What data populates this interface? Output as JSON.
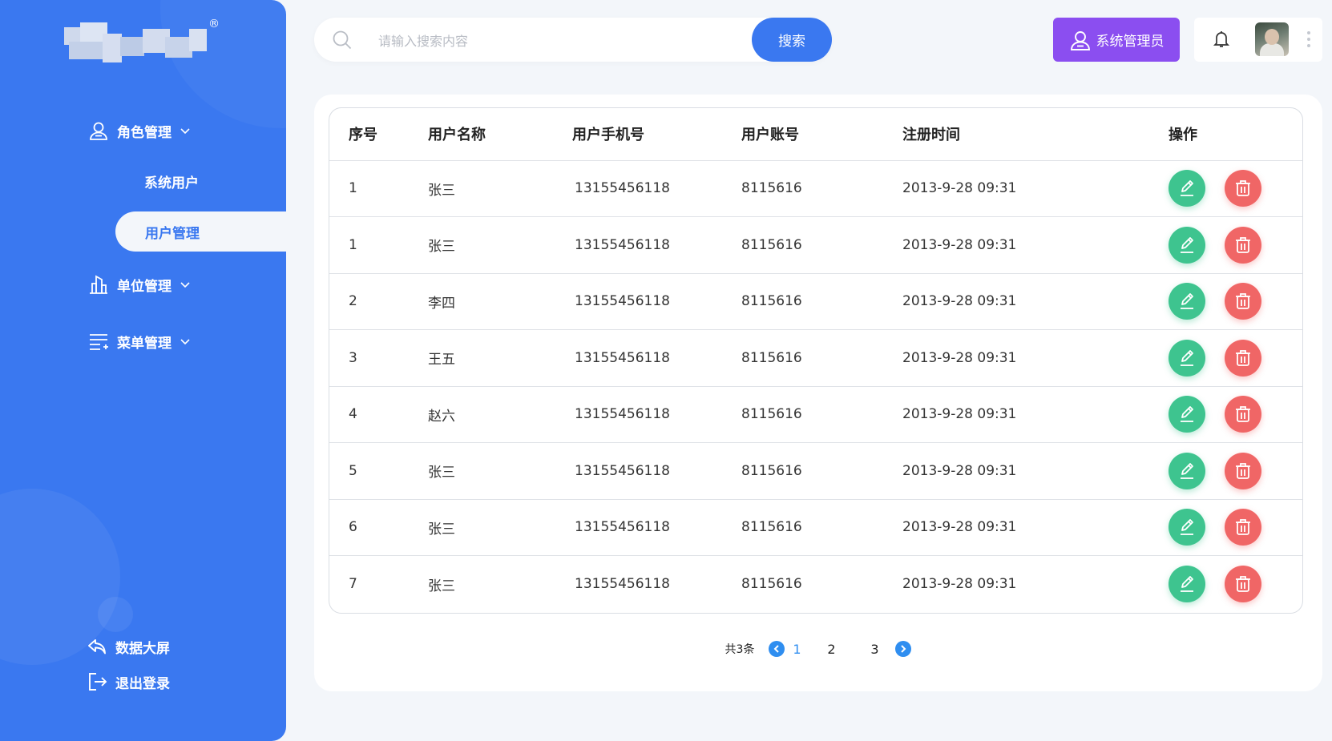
{
  "sidebar": {
    "nav": [
      {
        "label": "角色管理",
        "icon": "user-icon"
      },
      {
        "label": "单位管理",
        "icon": "building-icon"
      },
      {
        "label": "菜单管理",
        "icon": "menu-list-icon"
      }
    ],
    "sub_items": [
      {
        "label": "系统用户"
      },
      {
        "label": "用户管理",
        "active": true
      }
    ],
    "bottom": [
      {
        "label": "数据大屏",
        "icon": "back-arrow-icon"
      },
      {
        "label": "退出登录",
        "icon": "logout-icon"
      }
    ],
    "logo_mark": "®"
  },
  "header": {
    "search": {
      "placeholder": "请输入搜索内容",
      "value": ""
    },
    "search_button": "搜索",
    "admin_button": "系统管理员"
  },
  "table": {
    "columns": [
      "序号",
      "用户名称",
      "用户手机号",
      "用户账号",
      "注册时间",
      "操作"
    ],
    "rows": [
      {
        "index": "1",
        "name": "张三",
        "phone": "13155456118",
        "account": "8115616",
        "time": "2013-9-28 09:31"
      },
      {
        "index": "1",
        "name": "张三",
        "phone": "13155456118",
        "account": "8115616",
        "time": "2013-9-28 09:31"
      },
      {
        "index": "2",
        "name": "李四",
        "phone": "13155456118",
        "account": "8115616",
        "time": "2013-9-28 09:31"
      },
      {
        "index": "3",
        "name": "王五",
        "phone": "13155456118",
        "account": "8115616",
        "time": "2013-9-28 09:31"
      },
      {
        "index": "4",
        "name": "赵六",
        "phone": "13155456118",
        "account": "8115616",
        "time": "2013-9-28 09:31"
      },
      {
        "index": "5",
        "name": "张三",
        "phone": "13155456118",
        "account": "8115616",
        "time": "2013-9-28 09:31"
      },
      {
        "index": "6",
        "name": "张三",
        "phone": "13155456118",
        "account": "8115616",
        "time": "2013-9-28 09:31"
      },
      {
        "index": "7",
        "name": "张三",
        "phone": "13155456118",
        "account": "8115616",
        "time": "2013-9-28 09:31"
      }
    ]
  },
  "pagination": {
    "total": "共3条",
    "pages": [
      "1",
      "2",
      "3"
    ],
    "current": "1"
  },
  "colors": {
    "primary": "#3a78f0",
    "admin": "#8b4ef0",
    "edit": "#3ec48f",
    "delete": "#f06666",
    "pager_accent": "#2f8ef0"
  }
}
